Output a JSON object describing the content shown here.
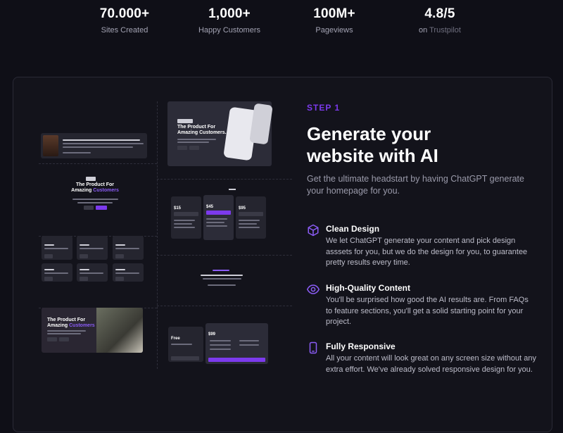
{
  "stats": [
    {
      "value": "70.000+",
      "label": "Sites Created",
      "label_muted": ""
    },
    {
      "value": "1,000+",
      "label": "Happy Customers",
      "label_muted": ""
    },
    {
      "value": "100M+",
      "label": "Pageviews",
      "label_muted": ""
    },
    {
      "value": "4.8/5",
      "label": "on ",
      "label_muted": "Trustpilot"
    }
  ],
  "section": {
    "step": "STEP 1",
    "headline_line1": "Generate your",
    "headline_line2": "website with AI",
    "subtitle": "Get the ultimate headstart by having ChatGPT generate your homepage for you."
  },
  "features": [
    {
      "icon": "cube-icon",
      "title": "Clean Design",
      "desc": "We let ChatGPT generate your content and pick design asssets for you, but we do the design for you, to guarantee pretty results every time."
    },
    {
      "icon": "eye-icon",
      "title": "High-Quality Content",
      "desc": "You'll be surprised how good the AI results are. From FAQs to feature sections, you'll get a solid starting point for your project."
    },
    {
      "icon": "mobile-icon",
      "title": "Fully Responsive",
      "desc": "All your content will look great on any screen size without any extra effort. We've already solved responsive design for you."
    }
  ],
  "collage": {
    "hero_title_1": "The Product For",
    "hero_title_2_plain": "Amazing ",
    "hero_title_2_accent": "Customers",
    "card_title_1": "The Product For",
    "card_title_2": "Amazing Customers.",
    "prices": [
      "$15",
      "$45",
      "$95"
    ],
    "price_free": "Free",
    "price_99": "$99"
  },
  "colors": {
    "accent": "#7c3aed",
    "background": "#0f0f17",
    "card": "#13131b"
  }
}
